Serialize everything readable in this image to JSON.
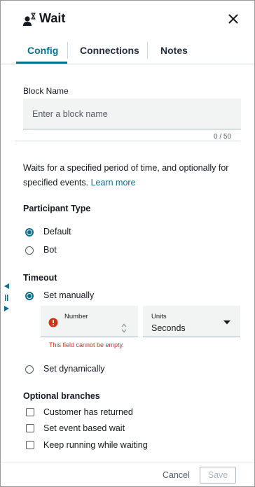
{
  "header": {
    "title": "Wait",
    "icon": "user-hourglass-icon",
    "close_icon": "close-icon"
  },
  "tabs": [
    {
      "label": "Config",
      "active": true
    },
    {
      "label": "Connections",
      "active": false
    },
    {
      "label": "Notes",
      "active": false
    }
  ],
  "block_name": {
    "label": "Block Name",
    "placeholder": "Enter a block name",
    "value": "",
    "counter": "0 / 50"
  },
  "description": {
    "text": "Waits for a specified period of time, and optionally for specified events.",
    "link": "Learn more"
  },
  "participant_type": {
    "heading": "Participant Type",
    "options": [
      {
        "label": "Default",
        "selected": true
      },
      {
        "label": "Bot",
        "selected": false
      }
    ]
  },
  "timeout": {
    "heading": "Timeout",
    "options": [
      {
        "label": "Set manually",
        "selected": true
      },
      {
        "label": "Set dynamically",
        "selected": false
      }
    ],
    "number_field": {
      "label": "Number",
      "value": "",
      "error": "This field cannot be empty."
    },
    "units_field": {
      "label": "Units",
      "value": "Seconds"
    }
  },
  "optional_branches": {
    "heading": "Optional branches",
    "options": [
      {
        "label": "Customer has returned",
        "checked": false
      },
      {
        "label": "Set event based wait",
        "checked": false
      },
      {
        "label": "Keep running while waiting",
        "checked": false
      }
    ]
  },
  "footer": {
    "cancel_label": "Cancel",
    "save_label": "Save"
  },
  "colors": {
    "accent": "#0d6d8c",
    "error": "#d13212"
  }
}
